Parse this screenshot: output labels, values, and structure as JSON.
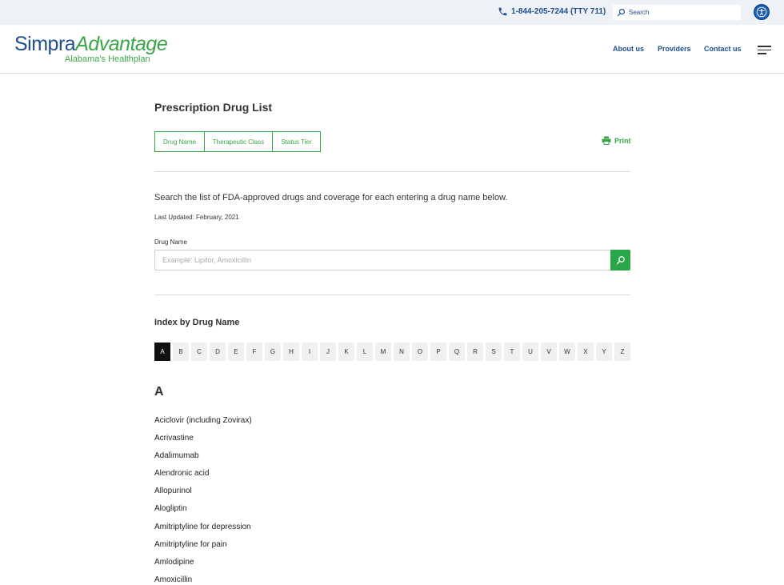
{
  "topbar": {
    "phone_icon": "phone-icon",
    "phone": "1-844-205-7244 (TTY 711)",
    "search_placeholder": "Search",
    "search_icon": "search-icon",
    "accessibility_icon": "accessibility-icon"
  },
  "header": {
    "logo_primary": "Simpra",
    "logo_secondary": "Advantage",
    "logo_tagline": "Alabama's Healthplan",
    "nav": [
      "About us",
      "Providers",
      "Contact us"
    ],
    "menu_icon": "hamburger-menu-icon"
  },
  "main": {
    "title": "Prescription Drug List",
    "tabs": [
      "Drug Name",
      "Therapeutic Class",
      "Status Tier"
    ],
    "print_label": "Print",
    "intro": "Search the list of FDA-approved drugs and coverage for each entering a drug name below.",
    "last_updated": "Last Updated: February, 2021",
    "field_label": "Drug Name",
    "field_placeholder": "Example: Lipitor, Amoxicillin",
    "field_value": "",
    "index_title": "Index by Drug Name",
    "letters": [
      "A",
      "B",
      "C",
      "D",
      "E",
      "F",
      "G",
      "H",
      "I",
      "J",
      "K",
      "L",
      "M",
      "N",
      "O",
      "P",
      "Q",
      "R",
      "S",
      "T",
      "U",
      "V",
      "W",
      "X",
      "Y",
      "Z"
    ],
    "active_letter": "A",
    "section_letter": "A",
    "drugs": [
      "Aciclovir (including Zovirax)",
      "Acrivastine",
      "Adalimumab",
      "Alendronic acid",
      "Allopurinol",
      "Alogliptin",
      "Amitriptyline for depression",
      "Amitriptyline for pain",
      "Amlodipine",
      "Amoxicillin"
    ]
  },
  "colors": {
    "brand_blue": "#1f4e8c",
    "brand_green": "#39a547",
    "button_green": "#2aa548",
    "topbar_bg": "#eef2f7"
  }
}
